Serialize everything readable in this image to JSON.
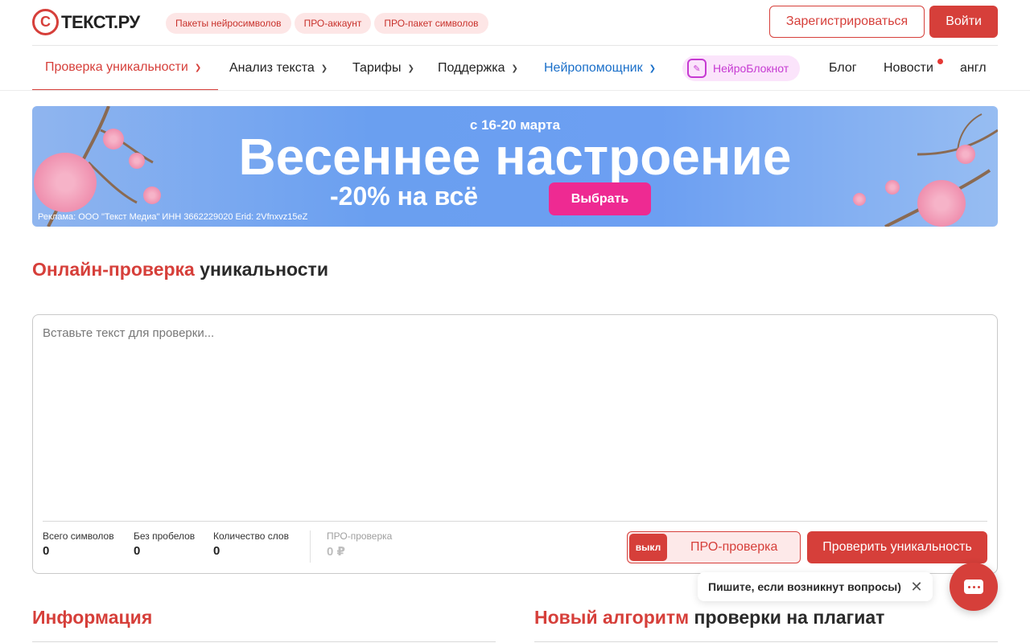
{
  "logo": {
    "mark": "С",
    "text": "ТЕКСТ.РУ"
  },
  "header": {
    "pills": [
      "Пакеты нейросимволов",
      "ПРО-аккаунт",
      "ПРО-пакет символов"
    ],
    "register_label": "Зарегистрироваться",
    "login_label": "Войти"
  },
  "nav": {
    "items": [
      {
        "label": "Проверка уникальности",
        "chevron": true,
        "state": "active"
      },
      {
        "label": "Анализ текста",
        "chevron": true
      },
      {
        "label": "Тарифы",
        "chevron": true
      },
      {
        "label": "Поддержка",
        "chevron": true
      },
      {
        "label": "Нейропомощник",
        "chevron": true,
        "state": "highlight"
      },
      {
        "label": "НейроБлокнот",
        "icon": "notebook-icon"
      },
      {
        "label": "Блог"
      },
      {
        "label": "Новости",
        "badge": "dot"
      },
      {
        "label": "англ"
      }
    ]
  },
  "banner": {
    "date": "с 16-20 марта",
    "title": "Весеннее настроение",
    "sale": "-20% на всё",
    "button_label": "Выбрать",
    "ad_note": "Реклама: ООО \"Текст Медиа\" ИНН 3662229020 Erid: 2Vfnxvz15eZ",
    "colors": {
      "background": "#6c9ff2",
      "button": "#ee2a92"
    }
  },
  "main": {
    "title_accent": "Онлайн-проверка",
    "title_rest": " уникальности",
    "textarea_placeholder": "Вставьте текст для проверки...",
    "stats": [
      {
        "label": "Всего символов",
        "value": "0"
      },
      {
        "label": "Без пробелов",
        "value": "0"
      },
      {
        "label": "Количество слов",
        "value": "0"
      },
      {
        "label": "ПРО-проверка",
        "value": "0 ₽"
      }
    ],
    "toggle": {
      "state_label": "выкл",
      "label": "ПРО-проверка"
    },
    "check_button": "Проверить уникальность"
  },
  "chat": {
    "prompt": "Пишите, если возникнут вопросы)",
    "close_icon": "close-icon",
    "button_icon": "chat-icon"
  },
  "sections": {
    "info_title": "Информация",
    "algo_accent": "Новый алгоритм",
    "algo_rest": " проверки на плагиат"
  },
  "colors": {
    "accent": "#d63f3a",
    "link_blue": "#1a6fc9",
    "neuro_pink": "#c63ad2"
  }
}
